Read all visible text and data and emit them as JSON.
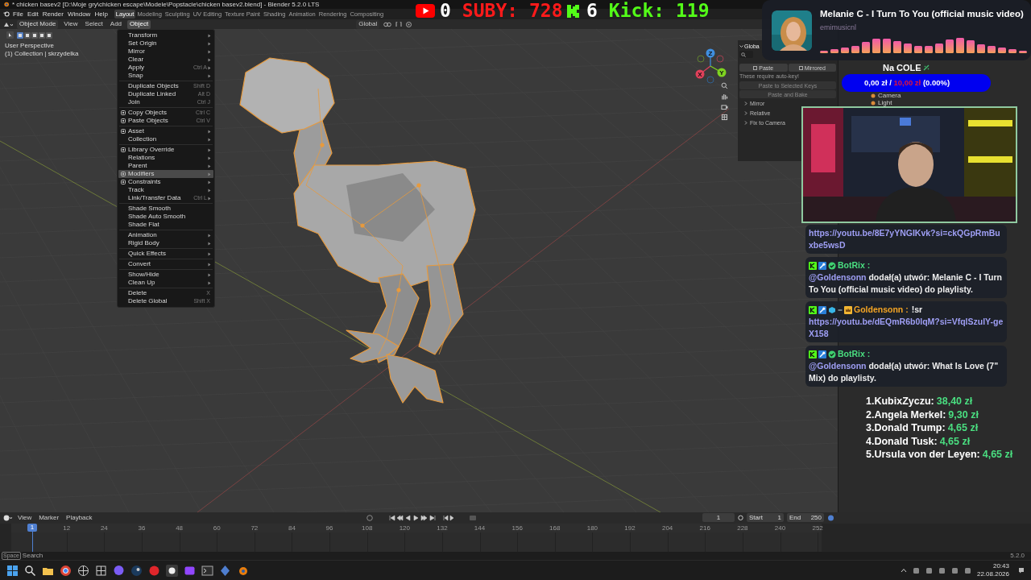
{
  "window": {
    "title": "* chicken basev2 [D:\\Moje gry\\chicken escape\\Modele\\Popstacie\\chicken basev2.blend] - Blender 5.2.0 LTS"
  },
  "menu_bar": [
    "File",
    "Edit",
    "Render",
    "Window",
    "Help"
  ],
  "workspace_tabs": [
    {
      "label": "Layout",
      "selected": true
    },
    {
      "label": "Modeling",
      "selected": false
    },
    {
      "label": "Sculpting",
      "selected": false
    },
    {
      "label": "UV Editing",
      "selected": false
    },
    {
      "label": "Texture Paint",
      "selected": false
    },
    {
      "label": "Shading",
      "selected": false
    },
    {
      "label": "Animation",
      "selected": false
    },
    {
      "label": "Rendering",
      "selected": false
    },
    {
      "label": "Compositing",
      "selected": false
    }
  ],
  "viewport_header": {
    "mode": "Object Mode",
    "menus": [
      {
        "label": "View",
        "selected": false
      },
      {
        "label": "Select",
        "selected": false
      },
      {
        "label": "Add",
        "selected": false
      },
      {
        "label": "Object",
        "selected": true
      }
    ],
    "orientation": "Global"
  },
  "viewport": {
    "view_name": "User Perspective",
    "collection": "(1) Collection | skrzydelka",
    "gizmo_axes": [
      "X",
      "Y",
      "Z"
    ]
  },
  "object_menu": {
    "groups": [
      [
        {
          "label": "Transform",
          "submenu": true,
          "icon": false,
          "selected": false
        },
        {
          "label": "Set Origin",
          "submenu": true,
          "icon": false,
          "selected": false
        },
        {
          "label": "Mirror",
          "submenu": true,
          "icon": false,
          "selected": false
        },
        {
          "label": "Clear",
          "submenu": true,
          "icon": false,
          "selected": false
        },
        {
          "label": "Apply",
          "shortcut": "Ctrl A",
          "submenu": true,
          "icon": false,
          "selected": false
        },
        {
          "label": "Snap",
          "submenu": true,
          "icon": false,
          "selected": false
        }
      ],
      [
        {
          "label": "Duplicate Objects",
          "shortcut": "Shift D",
          "submenu": false,
          "icon": false,
          "selected": false
        },
        {
          "label": "Duplicate Linked",
          "shortcut": "Alt D",
          "submenu": false,
          "icon": false,
          "selected": false
        },
        {
          "label": "Join",
          "shortcut": "Ctrl J",
          "submenu": false,
          "icon": false,
          "selected": false
        }
      ],
      [
        {
          "label": "Copy Objects",
          "shortcut": "Ctrl C",
          "submenu": false,
          "icon": true,
          "selected": false
        },
        {
          "label": "Paste Objects",
          "shortcut": "Ctrl V",
          "submenu": false,
          "icon": true,
          "selected": false
        }
      ],
      [
        {
          "label": "Asset",
          "submenu": true,
          "icon": true,
          "selected": false
        },
        {
          "label": "Collection",
          "submenu": true,
          "icon": false,
          "selected": false
        }
      ],
      [
        {
          "label": "Library Override",
          "submenu": true,
          "icon": true,
          "selected": false
        },
        {
          "label": "Relations",
          "submenu": true,
          "icon": false,
          "selected": false
        },
        {
          "label": "Parent",
          "submenu": true,
          "icon": false,
          "selected": false
        },
        {
          "label": "Modifiers",
          "submenu": true,
          "icon": true,
          "selected": true
        },
        {
          "label": "Constraints",
          "submenu": true,
          "icon": true,
          "selected": false
        },
        {
          "label": "Track",
          "submenu": true,
          "icon": false,
          "selected": false
        },
        {
          "label": "Link/Transfer Data",
          "shortcut": "Ctrl L",
          "submenu": true,
          "icon": false,
          "selected": false
        }
      ],
      [
        {
          "label": "Shade Smooth",
          "submenu": false,
          "icon": false,
          "selected": false
        },
        {
          "label": "Shade Auto Smooth",
          "submenu": false,
          "icon": false,
          "selected": false
        },
        {
          "label": "Shade Flat",
          "submenu": false,
          "icon": false,
          "selected": false
        }
      ],
      [
        {
          "label": "Animation",
          "submenu": true,
          "icon": false,
          "selected": false
        },
        {
          "label": "Rigid Body",
          "submenu": true,
          "icon": false,
          "selected": false
        }
      ],
      [
        {
          "label": "Quick Effects",
          "submenu": true,
          "icon": false,
          "selected": false
        }
      ],
      [
        {
          "label": "Convert",
          "submenu": true,
          "icon": false,
          "selected": false
        }
      ],
      [
        {
          "label": "Show/Hide",
          "submenu": true,
          "icon": false,
          "selected": false
        },
        {
          "label": "Clean Up",
          "submenu": true,
          "icon": false,
          "selected": false
        }
      ],
      [
        {
          "label": "Delete",
          "shortcut": "X",
          "submenu": false,
          "icon": false,
          "selected": false
        },
        {
          "label": "Delete Global",
          "shortcut": "Shift X",
          "submenu": false,
          "icon": false,
          "selected": false
        }
      ]
    ]
  },
  "sidebar": {
    "header": "Globa",
    "buttons": [
      "Paste",
      "Mirrored"
    ],
    "note": "These require auto-key!",
    "actions": [
      "Paste to Selected Keys",
      "Paste and Bake"
    ],
    "sections": [
      "Mirror",
      "Relative",
      "Fix to Camera"
    ]
  },
  "outliner": {
    "items": [
      "Camera",
      "Light"
    ]
  },
  "timeline": {
    "menus": [
      "View",
      "Marker",
      "Playback"
    ],
    "current_frame": "1",
    "start_label": "Start",
    "start": "1",
    "end_label": "End",
    "end": "250",
    "playhead": "1",
    "ticks": [
      "12",
      "24",
      "36",
      "48",
      "60",
      "72",
      "84",
      "96",
      "108",
      "120",
      "132",
      "144",
      "156",
      "168",
      "180",
      "192",
      "204",
      "216",
      "228",
      "240",
      "252"
    ]
  },
  "status_bar": {
    "key": "Space",
    "search": "Search",
    "version": "5.2.0"
  },
  "stream": {
    "youtube": {
      "count": "0",
      "subs": "SUBY: 728"
    },
    "kick": {
      "count": "6",
      "followers": "Kick: 119"
    },
    "now_playing": {
      "title": "Melanie C - I Turn To You (official music video)",
      "channel": "emimusicnl"
    },
    "goal": {
      "title": "Na COLE",
      "current": "0,00 zł / ",
      "target": "10,00 zł",
      "percent": " (0.00%)",
      "level": 0
    },
    "chat": [
      {
        "kind": "continuation",
        "link": "https://youtu.be/8E7yYNGIKvk?si=ckQGpRmBuxbe5wsD"
      },
      {
        "kind": "bot",
        "user": "BotRix",
        "color": "#4ade80",
        "sep": " :",
        "mention": "@Goldensonn",
        "text": " dodał(a) utwór: Melanie C - I Turn To You (official music video) do playlisty."
      },
      {
        "kind": "viewer",
        "user": "Goldensonn",
        "color": "#f5a524",
        "sep": " :",
        "text": "!sr",
        "link": "https://youtu.be/dEQmR6b0lqM?si=VfqlSzulY-geX158"
      },
      {
        "kind": "bot",
        "user": "BotRix",
        "color": "#4ade80",
        "sep": " :",
        "mention": "@Goldensonn",
        "text": " dodał(a) utwór: What Is Love (7\" Mix) do playlisty."
      }
    ],
    "leaderboard": [
      {
        "rank": "1.",
        "name": "KubixZyczu:",
        "amount": "38,40 zł"
      },
      {
        "rank": "2.",
        "name": "Angela Merkel:",
        "amount": "9,30 zł"
      },
      {
        "rank": "3.",
        "name": "Donald Trump:",
        "amount": "4,65 zł"
      },
      {
        "rank": "4.",
        "name": "Donald Tusk:",
        "amount": "4,65 zł"
      },
      {
        "rank": "5.",
        "name": "Ursula von der Leyen:",
        "amount": "4,65 zł"
      }
    ]
  },
  "taskbar": {
    "time": "20:43",
    "date": "22.08.2026"
  }
}
